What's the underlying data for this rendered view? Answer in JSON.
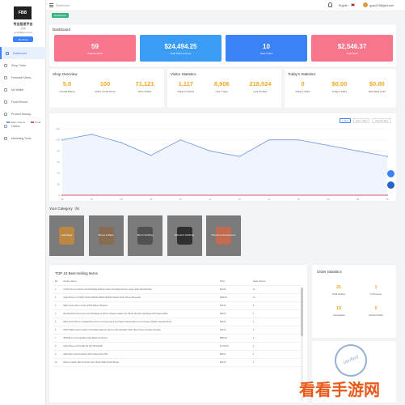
{
  "sidebar": {
    "logo_text": "FBB",
    "shop_name": "专业批发平台",
    "shop_sub": "店铺",
    "email": "gy123@gml.com",
    "shop_button": "My Shop",
    "items": [
      {
        "label": "Dashboard",
        "icon": "dashboard-icon",
        "active": true
      },
      {
        "label": "Shop Order",
        "icon": "order-icon"
      },
      {
        "label": "Financial Mana...",
        "icon": "finance-icon"
      },
      {
        "label": "My Wallet",
        "icon": "wallet-icon"
      },
      {
        "label": "Fund Record",
        "icon": "record-icon"
      },
      {
        "label": "Product Manag...",
        "icon": "product-icon"
      },
      {
        "label": "Others",
        "icon": "others-icon"
      },
      {
        "label": "Marketing Tools",
        "icon": "marketing-icon"
      }
    ]
  },
  "topbar": {
    "breadcrumb": "Dashboard",
    "language": "English",
    "user_email": "gyan123@gml.com"
  },
  "tab": {
    "label": "Dashboard"
  },
  "dashboard": {
    "title": "Dashboard",
    "kpis": [
      {
        "value": "59",
        "label": "Total Products",
        "color": "#f8768c"
      },
      {
        "value": "$24,494.25",
        "label": "Total Sales Amount",
        "color": "#3b9cf6"
      },
      {
        "value": "10",
        "label": "Total Orders",
        "color": "#3b82f6"
      },
      {
        "value": "$2,546.37",
        "label": "Total Profit",
        "color": "#f8768c"
      }
    ]
  },
  "shop_overview": {
    "title": "Shop Overview",
    "stats": [
      {
        "value": "5.0",
        "label": "Overall Rating"
      },
      {
        "value": "100",
        "label": "Seller Credit Score"
      },
      {
        "value": "71,121",
        "label": "Store Follow"
      }
    ]
  },
  "visitor_statistics": {
    "title": "Visitor Statistics",
    "stats": [
      {
        "value": "1,117",
        "label": "Today's Visitors"
      },
      {
        "value": "8,906",
        "label": "Last 7 days"
      },
      {
        "value": "218,024",
        "label": "Last 30 days"
      }
    ]
  },
  "today_statistics": {
    "title": "Today's Statistics",
    "stats": [
      {
        "value": "0",
        "label": "Today's Order"
      },
      {
        "value": "$0.00",
        "label": "Today's Sales"
      },
      {
        "value": "$0.00",
        "label": "Estimated profit"
      }
    ]
  },
  "chart_legend": {
    "series_a": "Sales Volume",
    "series_b": "Profit"
  },
  "range_buttons": [
    "7 days",
    "Last 7 days",
    "Last 30 days"
  ],
  "colors": {
    "accent": "#3b82f6",
    "orange": "#f5a623",
    "line": "#6b93e6",
    "red": "#e05561"
  },
  "chart_data": {
    "type": "line",
    "x": [
      "06",
      "07",
      "08",
      "09",
      "10",
      "11",
      "12",
      "01",
      "02",
      "03",
      "04",
      "05"
    ],
    "ylim": [
      0,
      120
    ],
    "y_ticks": [
      "120",
      "100",
      "80",
      "60",
      "40",
      "20",
      "0"
    ],
    "series": [
      {
        "name": "Sales Volume",
        "values": [
          100,
          110,
          95,
          72,
          100,
          80,
          70,
          100,
          100,
          90,
          80,
          70
        ]
      },
      {
        "name": "Profit",
        "values": [
          0,
          0,
          0,
          0,
          0,
          0,
          0,
          0,
          0,
          0,
          0,
          0
        ]
      }
    ]
  },
  "category": {
    "title": "Your Category（5）",
    "items": [
      {
        "label": "Handbags",
        "tint": "#c8893a"
      },
      {
        "label": "Shoes & Bags",
        "tint": "#8a6a4a"
      },
      {
        "label": "Men's Clothing",
        "tint": "#4a4a4a"
      },
      {
        "label": "Women's Clothing",
        "tint": "#222222"
      },
      {
        "label": "Phones & Accessories",
        "tint": "#d0684a"
      }
    ]
  },
  "top_products": {
    "title": "TOP 10 Best-Selling Items",
    "columns": [
      "Rk",
      "Product Name",
      "Price",
      "Sales Volume"
    ],
    "rows": [
      [
        "1",
        "CCCD Purse for Women Set Handbags Satchel Leather Tote Bags Fashion Large Ladies Shoulder Bag",
        "$32.99",
        "10"
      ],
      [
        "2",
        "Apple iPhone 12 (64GB, 5G/4G) 256GB 128GB 64GB All Models Smart Phone (Renewed)",
        "$499.99",
        "10"
      ],
      [
        "3",
        "Ralph Lauren Men's Cotton POPS Blazer (Wraped)",
        "$75.99",
        "5"
      ],
      [
        "4",
        "Montana West Tote Purses and Handbags for Women Square Leather Top Handle Shoulder Handbags with Dragon Wallet",
        "$36.50",
        "4"
      ],
      [
        "5",
        "ZKEL 25-6-8 Women Cocktail Party Dress Cross Evening A-line Pleated Casual Stylist A Line Dresses Pinkish Lady Red Floral",
        "$29.50",
        "4"
      ],
      [
        "6",
        "TOM TIGER Loafers Leather Comfortable Bags for Women with Adjustable Strap Tassel Travel Cowhide Tote Bag",
        "$44.50",
        "3"
      ],
      [
        "7",
        "IPHONE 12 11 Compatible Apple Watch 40 49 Sets",
        "$899.99",
        "3"
      ],
      [
        "8",
        "Apple iPhone 13 Pro Max 5G 128 256 512GB",
        "$1,789.99",
        "2"
      ],
      [
        "9",
        "Ralph Men's Denim Pullover Short Sleeve Polo Shirt",
        "$59.00",
        "2"
      ],
      [
        "10",
        "Women Leather Belt Cross Slim Grey Brown Belts Pocket Buckle",
        "$22.00",
        "1"
      ]
    ]
  },
  "order_statistics": {
    "title": "Order Statistics",
    "stats": [
      {
        "value": "21",
        "label": "Total Orders"
      },
      {
        "value": "1",
        "label": "In Process"
      },
      {
        "value": "10",
        "label": "Completed"
      },
      {
        "value": "0",
        "label": "Cancel Order"
      }
    ]
  },
  "stamp_text": "Verified",
  "watermark_text": "看看手游网"
}
